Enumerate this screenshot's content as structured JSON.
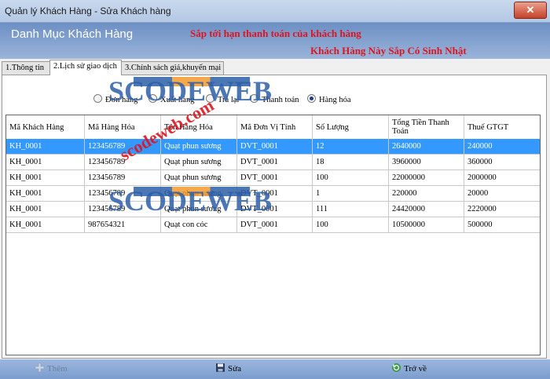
{
  "window": {
    "title": "Quản lý Khách Hàng - Sửa Khách hàng"
  },
  "header": {
    "title": "Danh Mục Khách Hàng",
    "alert_payment": "Sắp tới hạn thanh toán của khách hàng",
    "alert_birthday": "Khách Hàng Này Sắp Có Sinh Nhật"
  },
  "tabs": [
    {
      "label": "1.Thông tin"
    },
    {
      "label": "2.Lịch sử giao dịch"
    },
    {
      "label": "3.Chính sách giá,khuyến mại"
    }
  ],
  "filters": [
    {
      "label": "Đơn hàng",
      "selected": false
    },
    {
      "label": "Xuất hàng",
      "selected": false
    },
    {
      "label": "Trả lại",
      "selected": false
    },
    {
      "label": "Thanh toán",
      "selected": false
    },
    {
      "label": "Hàng hóa",
      "selected": true
    }
  ],
  "table": {
    "columns": [
      "Mã Khách Hàng",
      "Mã Hàng Hóa",
      "Tên Hàng Hóa",
      "Mã Đơn Vị Tính",
      "Số Lượng",
      "Tổng Tiền Thanh Toán",
      "Thuế GTGT"
    ],
    "rows": [
      [
        "KH_0001",
        "123456789",
        "Quạt phun sương",
        "DVT_0001",
        "12",
        "2640000",
        "240000"
      ],
      [
        "KH_0001",
        "123456789",
        "Quạt phun sương",
        "DVT_0001",
        "18",
        "3960000",
        "360000"
      ],
      [
        "KH_0001",
        "123456789",
        "Quạt phun sương",
        "DVT_0001",
        "100",
        "22000000",
        "2000000"
      ],
      [
        "KH_0001",
        "123456789",
        "Quạt phun sương",
        "DVT_0001",
        "1",
        "220000",
        "20000"
      ],
      [
        "KH_0001",
        "123456789",
        "Quạt phun sương",
        "DVT_0001",
        "111",
        "24420000",
        "2220000"
      ],
      [
        "KH_0001",
        "987654321",
        "Quạt con cóc",
        "DVT_0001",
        "100",
        "10500000",
        "500000"
      ]
    ],
    "selected_row": 0
  },
  "footer": {
    "add_label": "Thêm",
    "save_label": "Sửa",
    "back_label": "Trở về"
  },
  "watermark": {
    "brand": "SCODEWEB",
    "site": "scodeweb.com"
  },
  "colors": {
    "accent": "#3399ff",
    "alert": "#e0141e",
    "header": "#7a9bce"
  }
}
